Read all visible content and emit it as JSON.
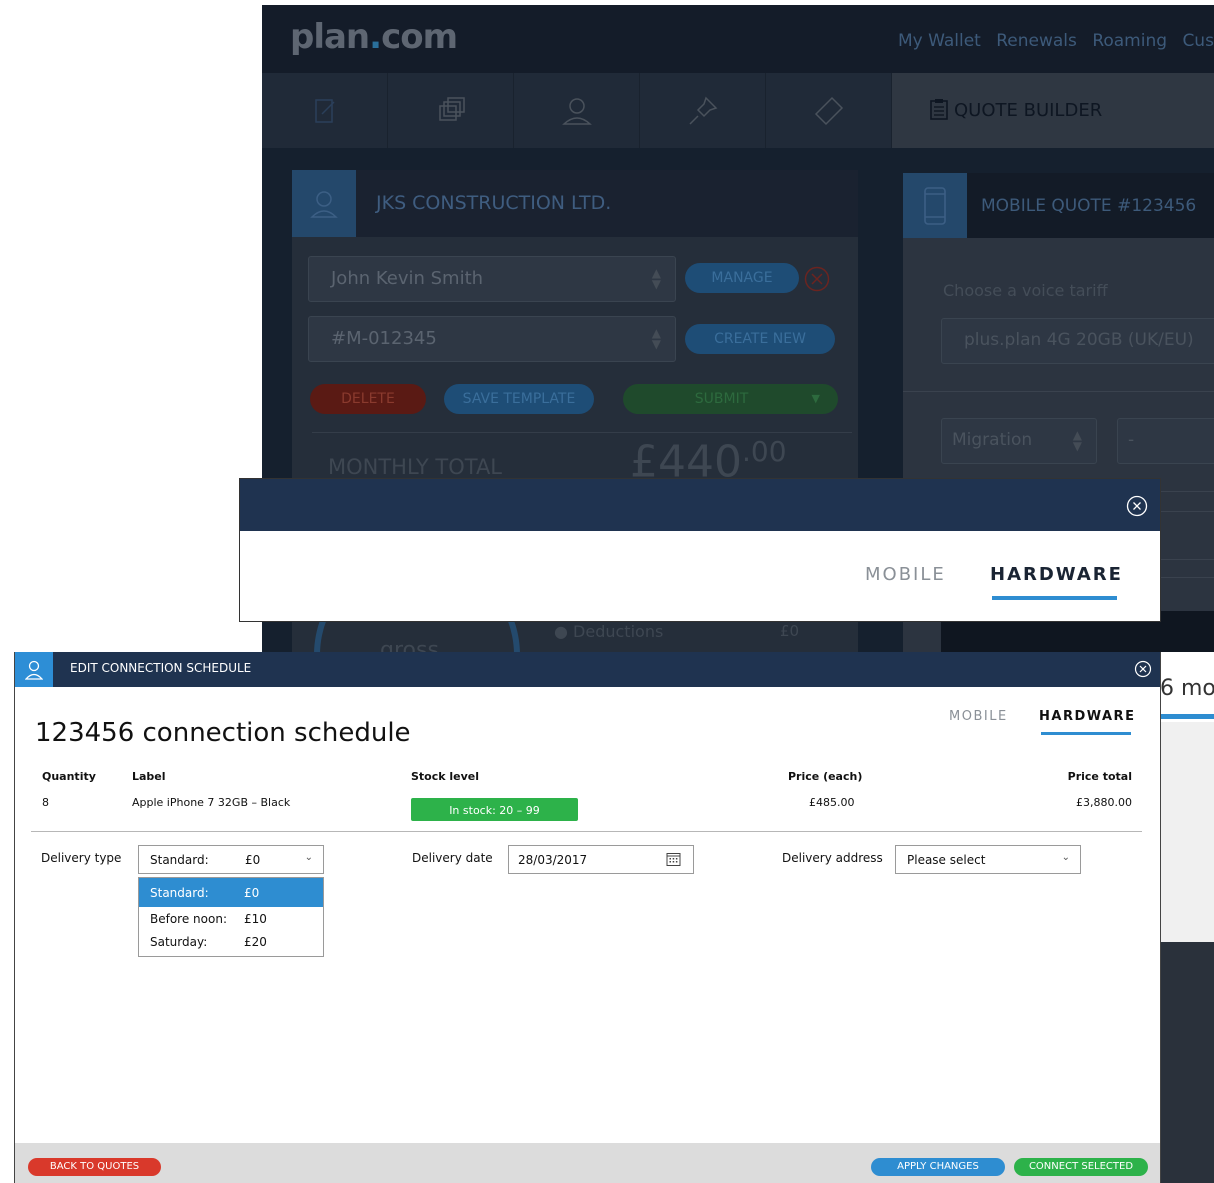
{
  "app": {
    "logo": "plan.com",
    "nav": [
      "My Wallet",
      "Renewals",
      "Roaming",
      "Custo"
    ],
    "quote_builder": "QUOTE BUILDER",
    "company": "JKS CONSTRUCTION LTD.",
    "contact": "John Kevin Smith",
    "account": "#M-012345",
    "manage": "MANAGE",
    "create_new": "CREATE NEW",
    "delete": "DELETE",
    "save_template": "SAVE TEMPLATE",
    "submit": "SUBMIT",
    "monthly_total": "MONTHLY TOTAL",
    "price_main": "£440",
    "price_cents": ".00",
    "gross": "gross",
    "deductions": "Deductions",
    "deductions_val": "£0",
    "mobile_quote": "MOBILE QUOTE #123456",
    "choose_tariff": "Choose a voice tariff",
    "tariff": "plus.plan 4G 20GB (UK/EU)",
    "migration": "Migration",
    "dash": "-",
    "months": "6 mo"
  },
  "tab_modal": {
    "tabs": [
      "MOBILE",
      "HARDWARE"
    ],
    "active": "HARDWARE"
  },
  "modal": {
    "header": "EDIT CONNECTION SCHEDULE",
    "title": "123456 connection schedule",
    "tabs": [
      "MOBILE",
      "HARDWARE"
    ],
    "columns": [
      "Quantity",
      "Label",
      "Stock level",
      "Price (each)",
      "Price total"
    ],
    "row": {
      "quantity": "8",
      "label": "Apple iPhone 7 32GB – Black",
      "stock": "In stock: 20 – 99",
      "price_each": "£485.00",
      "price_total": "£3,880.00"
    },
    "delivery_type_label": "Delivery type",
    "delivery_type_value": {
      "name": "Standard:",
      "price": "£0"
    },
    "delivery_options": [
      {
        "name": "Standard:",
        "price": "£0"
      },
      {
        "name": "Before noon:",
        "price": "£10"
      },
      {
        "name": "Saturday:",
        "price": "£20"
      }
    ],
    "delivery_date_label": "Delivery date",
    "delivery_date": "28/03/2017",
    "delivery_address_label": "Delivery address",
    "delivery_address": "Please select",
    "back_button": "BACK TO QUOTES",
    "apply_button": "APPLY CHANGES",
    "connect_button": "CONNECT SELECTED"
  },
  "colors": {
    "header": "#1f3350",
    "accent": "#2e8dd1",
    "green": "#2db24a",
    "red": "#d9392b"
  }
}
